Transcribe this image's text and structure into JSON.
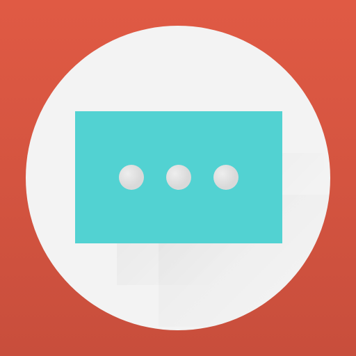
{
  "icon": {
    "name": "message-ellipsis-icon",
    "background_color": "#d95743",
    "circle_color": "#f3f3f3",
    "card_color": "#52d2d2",
    "dot_color": "#d9d9d9",
    "dots_count": 3
  }
}
